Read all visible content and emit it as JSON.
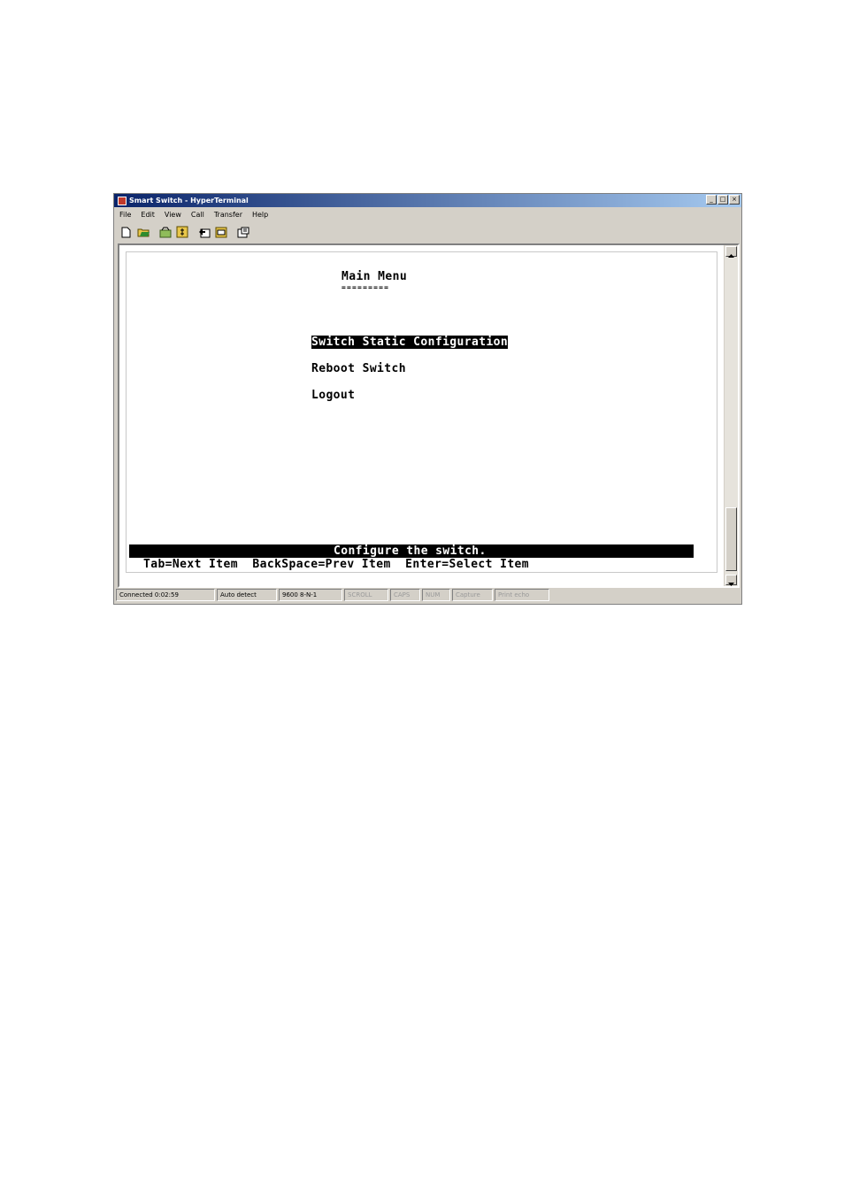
{
  "window": {
    "title": "Smart Switch - HyperTerminal",
    "buttons": [
      "_",
      "□",
      "×"
    ]
  },
  "menu": [
    "File",
    "Edit",
    "View",
    "Call",
    "Transfer",
    "Help"
  ],
  "toolbar": [
    "new-icon",
    "open-icon",
    "connect-icon",
    "disconnect-icon",
    "send-icon",
    "receive-icon",
    "properties-icon"
  ],
  "terminal": {
    "heading": "Main Menu",
    "underline": "=========",
    "items": [
      {
        "label": "Switch Static Configuration",
        "selected": true
      },
      {
        "label": "Reboot Switch",
        "selected": false
      },
      {
        "label": "Logout",
        "selected": false
      }
    ],
    "description": "Configure the switch.",
    "help": "Tab=Next Item  BackSpace=Prev Item  Enter=Select Item"
  },
  "statusbar": {
    "connected": "Connected 0:02:59",
    "detect": "Auto detect",
    "settings": "9600 8-N-1",
    "scroll": "SCROLL",
    "caps": "CAPS",
    "num": "NUM",
    "capture": "Capture",
    "echo": "Print echo"
  }
}
